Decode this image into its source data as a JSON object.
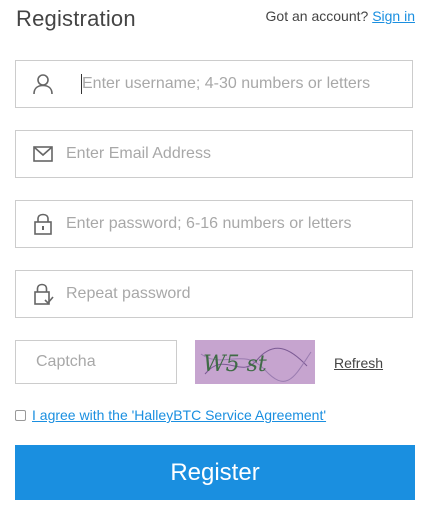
{
  "header": {
    "title": "Registration",
    "account_prompt": "Got an account?",
    "sign_in_label": "Sign in"
  },
  "form": {
    "username_placeholder": "Enter username; 4-30 numbers or letters",
    "email_placeholder": "Enter Email Address",
    "password_placeholder": "Enter password; 6-16 numbers or letters",
    "repeat_placeholder": "Repeat password",
    "captcha_placeholder": "Captcha",
    "captcha_image_text": "W5 st",
    "refresh_label": "Refresh",
    "agreement_label": "I agree with the 'HalleyBTC Service Agreement'",
    "agreement_checked": false,
    "register_label": "Register"
  },
  "colors": {
    "accent": "#1a8fe0",
    "captcha_bg": "#c6a4cf",
    "border": "#cccccc"
  },
  "icons": {
    "username": "user-icon",
    "email": "envelope-icon",
    "password": "lock-icon",
    "repeat": "lock-check-icon"
  }
}
